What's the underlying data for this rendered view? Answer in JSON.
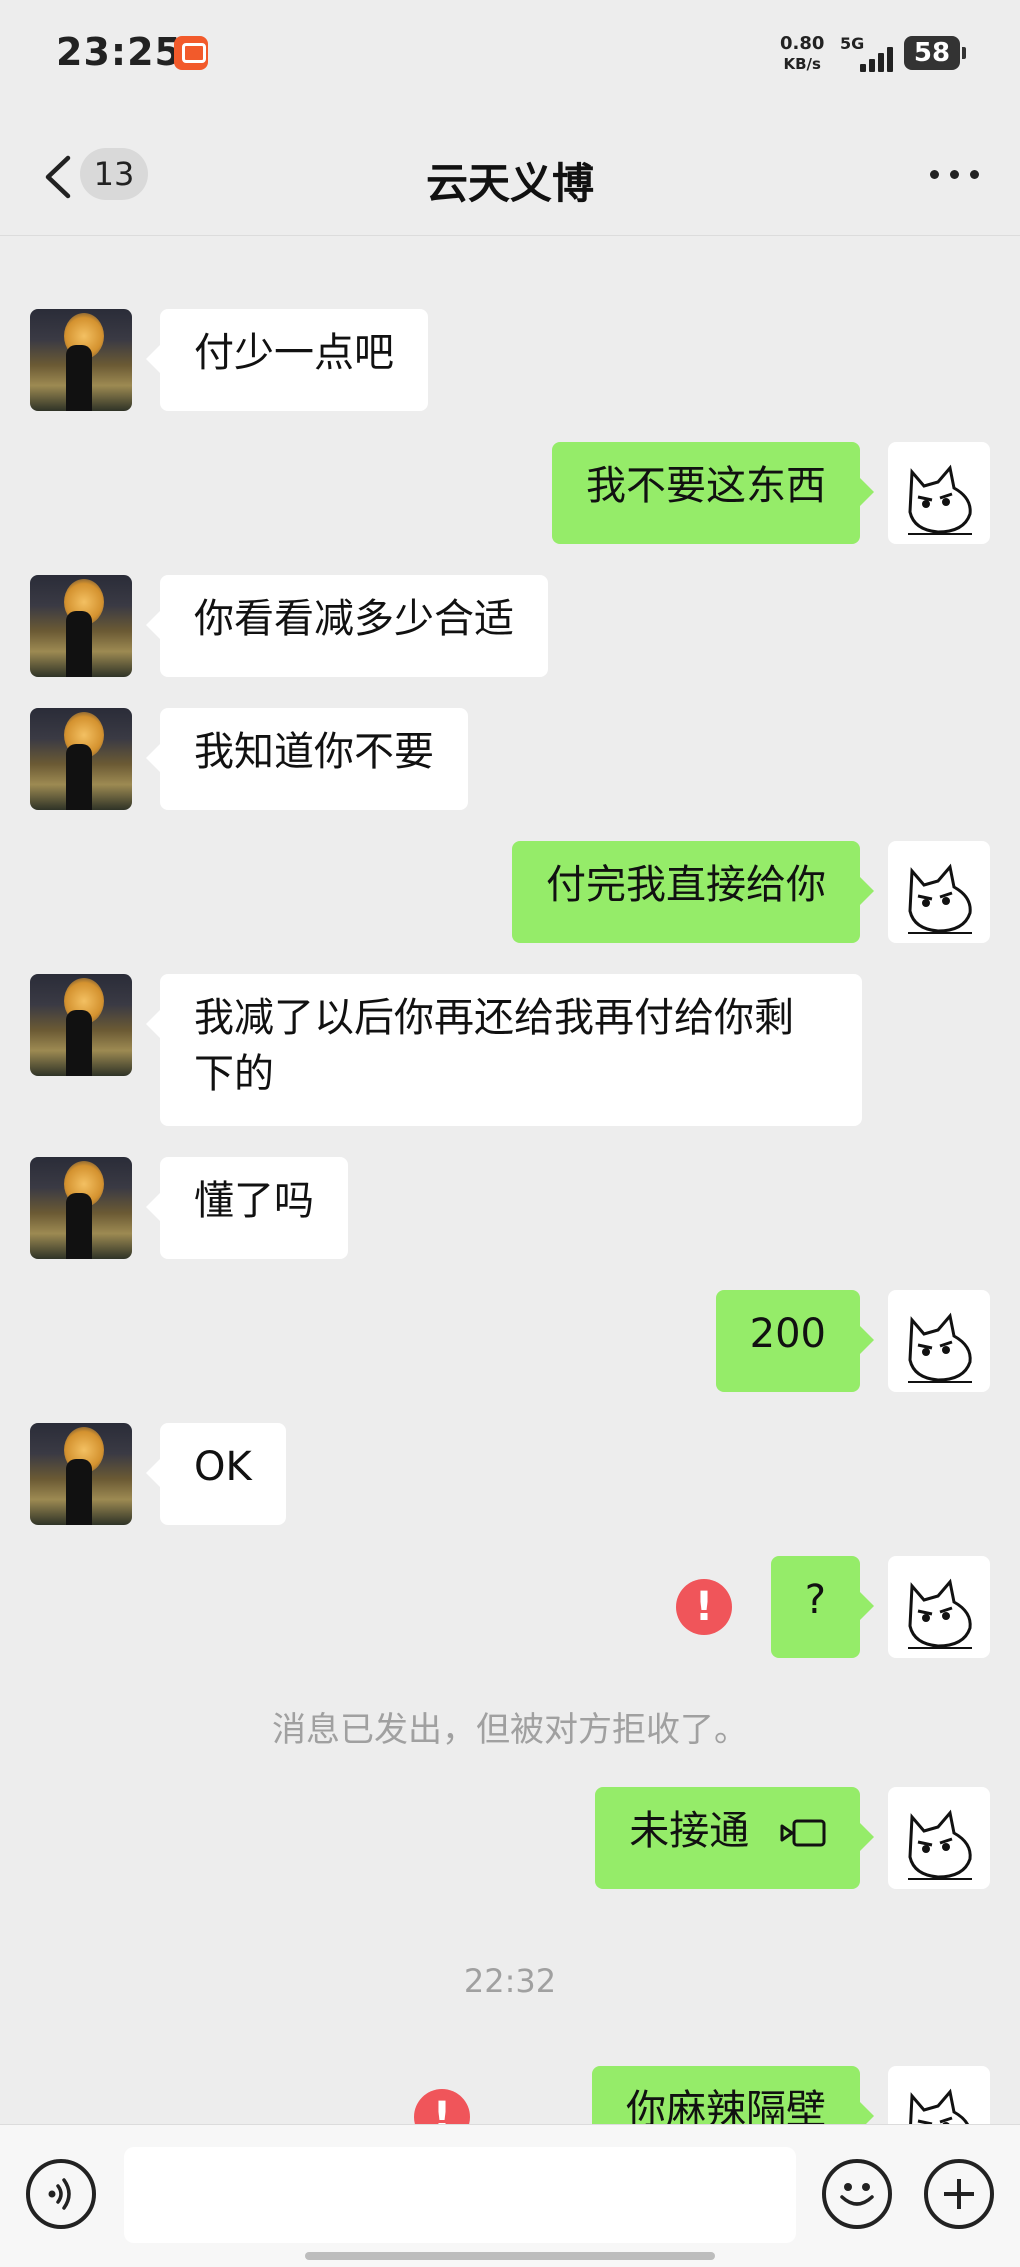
{
  "status_bar": {
    "time": "23:25",
    "net_speed_value": "0.80",
    "net_speed_unit": "KB/s",
    "network": "5G",
    "battery": "58"
  },
  "nav": {
    "unread_count": "13",
    "title": "云天义博"
  },
  "messages": [
    {
      "side": "in",
      "text": "付少一点吧"
    },
    {
      "side": "out",
      "text": "我不要这东西"
    },
    {
      "side": "in",
      "text": "你看看减多少合适"
    },
    {
      "side": "in",
      "text": "我知道你不要"
    },
    {
      "side": "out",
      "text": "付完我直接给你"
    },
    {
      "side": "in",
      "text_line1": "我减了以后你再还给我再付给你剩",
      "text_line2": "下的"
    },
    {
      "side": "in",
      "text": "懂了吗"
    },
    {
      "side": "out",
      "text": "200"
    },
    {
      "side": "in",
      "text": "OK"
    },
    {
      "side": "out",
      "text": "?",
      "failed": true,
      "error_mark": "!"
    },
    {
      "side": "system",
      "text": "消息已发出，但被对方拒收了。"
    },
    {
      "side": "out",
      "text": "未接通",
      "icon": "video-call-icon"
    },
    {
      "side": "timestamp",
      "text": "22:32"
    },
    {
      "side": "out",
      "text": "你麻辣隔壁",
      "failed": true,
      "error_mark": "!"
    }
  ],
  "colors": {
    "background": "#ededed",
    "outgoing_bubble": "#95ec69",
    "incoming_bubble": "#ffffff",
    "error": "#f0555a"
  },
  "input_bar": {
    "placeholder": ""
  }
}
